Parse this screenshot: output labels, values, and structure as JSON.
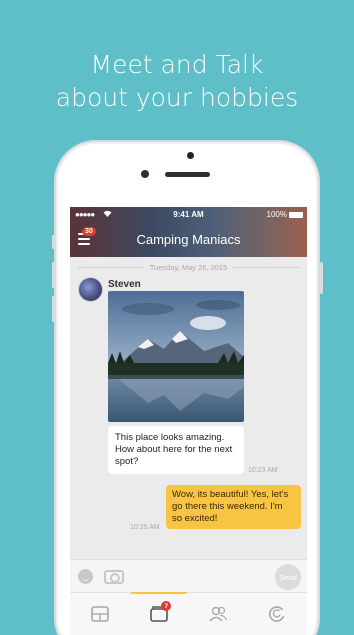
{
  "headline": {
    "line1": "Meet and Talk",
    "line2": "about your hobbies"
  },
  "status_bar": {
    "signal": "●●●●●",
    "time": "9:41 AM",
    "battery": "100%"
  },
  "chat": {
    "title": "Camping Maniacs",
    "unread_badge": "30",
    "date_separator": "Tuesday, May 26, 2015"
  },
  "messages": [
    {
      "sender": "Steven",
      "text": "This place looks amazing. How about here for the next spot?",
      "time": "10:23 AM"
    },
    {
      "sender": "",
      "text": "Wow, its beautiful! Yes, let's go there this weekend. I'm so excited!",
      "time": "10:25 AM"
    }
  ],
  "composer": {
    "send_label": "Send"
  },
  "tabbar": {
    "chats_badge": "7",
    "icons": [
      "board-icon",
      "chat-icon",
      "people-icon",
      "refresh-icon"
    ]
  },
  "colors": {
    "background": "#5fbfc9",
    "outgoing_bubble": "#f8c444",
    "badge": "#e0392f"
  }
}
